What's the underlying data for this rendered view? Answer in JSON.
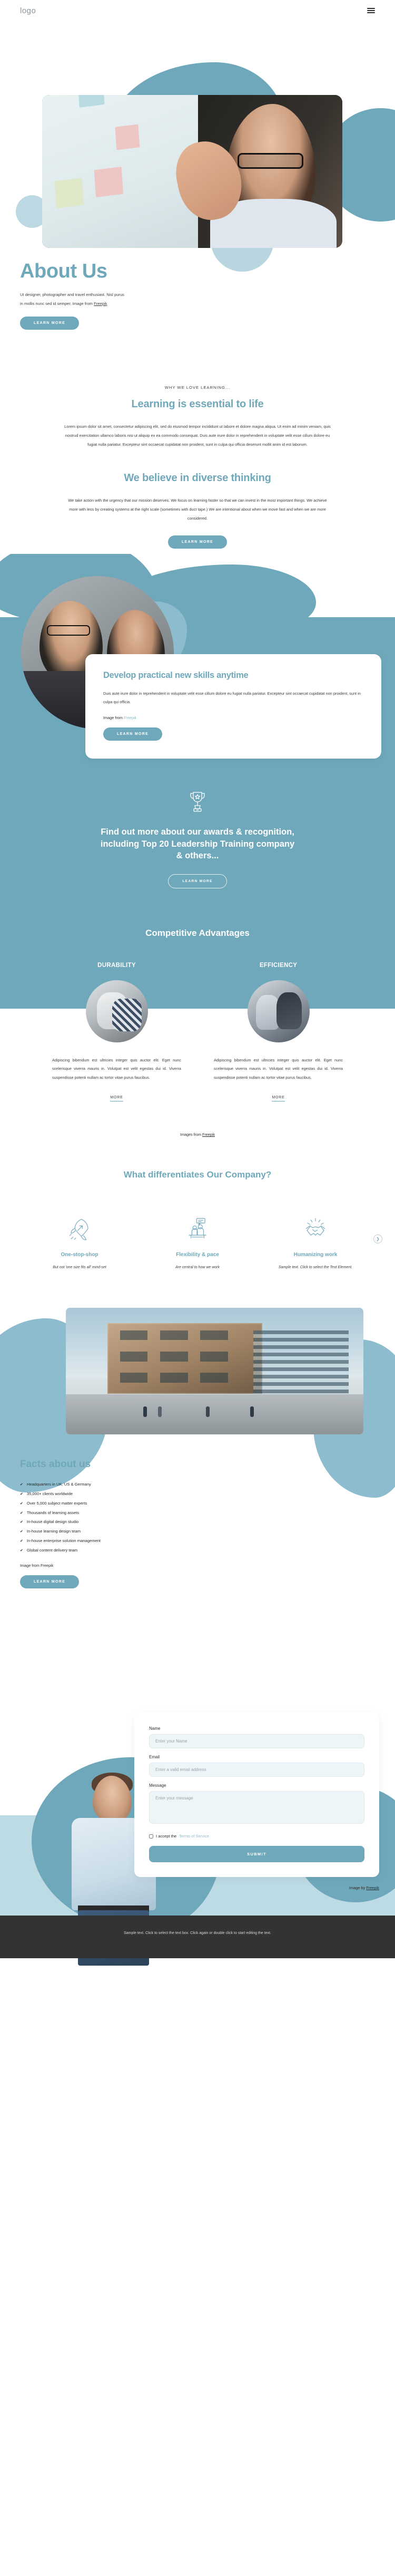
{
  "header": {
    "logo": "logo",
    "menu_icon": "hamburger-menu-icon"
  },
  "hero": {
    "title": "About Us",
    "paragraph": "UI designer, photographer and travel enthusiast. Nisl purus in mollis nunc sed id semper.  Image from ",
    "credit_link": "Freepik",
    "cta": "LEARN MORE"
  },
  "learning": {
    "eyebrow": "WHY WE LOVE LEARNING...",
    "title": "Learning is essential to life",
    "paragraph": "Lorem ipsum dolor sit amet, consectetur adipiscing elit, sed do eiusmod tempor incididunt ut labore et dolore magna aliqua. Ut enim ad minim veniam, quis nostrud exercitation ullamco laboris nisi ut aliquip ex ea commodo consequat. Duis aute irure dolor in reprehenderit in voluptate velit esse cillum dolore eu fugiat nulla pariatur. Excepteur sint occaecat cupidatat non proident, sunt in culpa qui officia deserunt mollit anim id est laborum."
  },
  "diverse": {
    "title": "We believe in diverse thinking",
    "paragraph": "We take action with the urgency that our mission deserves. We focus on learning faster so that we can invest in the most important things. We achieve more with less by creating systems at the right scale (sometimes with duct tape.) We are intentional about when we move fast and when we are more considered.",
    "cta": "LEARN MORE"
  },
  "skills": {
    "title": "Develop practical new skills anytime",
    "paragraph": "Duis aute irure dolor in reprehenderit in voluptate velit esse cillum dolore eu fugiat nulla pariatur. Excepteur sint occaecat cupidatat non proident, sunt in culpa qui officia.",
    "credit_prefix": "Image from ",
    "credit_link": "Freepik",
    "cta": "LEARN MORE"
  },
  "awards": {
    "icon": "trophy-icon",
    "title": "Find out more about our awards & recognition, including Top 20 Leadership Training company & others...",
    "cta": "LEARN MORE"
  },
  "competitive": {
    "title": "Competitive Advantages",
    "columns": [
      {
        "heading": "DURABILITY",
        "image": "people-working-photo",
        "paragraph": "Adipiscing bibendum est ultricies integer quis auctor elit. Eget nunc scelerisque viverra mauris in. Volutpat est velit egestas dui id. Viverra suspendisse potenti nullam ac tortor vitae purus faucibus.",
        "more": "MORE"
      },
      {
        "heading": "EFFICIENCY",
        "image": "business-meeting-photo",
        "paragraph": "Adipiscing bibendum est ultricies integer quis auctor elit. Eget nunc scelerisque viverra mauris in. Volutpat est velit egestas dui id. Viverra suspendisse potenti nullam ac tortor vitae purus faucibus.",
        "more": "MORE"
      }
    ],
    "credit_prefix": "Images from ",
    "credit_link": "Freepik"
  },
  "differentiates": {
    "title": "What differentiates Our Company?",
    "next_icon": "chevron-right-icon",
    "items": [
      {
        "icon": "rocket-icon",
        "heading": "One-stop-shop",
        "text": "But not 'one size fits all' mind-set"
      },
      {
        "icon": "meeting-presentation-icon",
        "heading": "Flexibility & pace",
        "text": "Are central to how we work"
      },
      {
        "icon": "handshake-icon",
        "heading": "Humanizing work",
        "text": "Sample text. Click to select the Text Element."
      }
    ]
  },
  "facts": {
    "image": "modern-office-building-photo",
    "title": "Facts about us",
    "tick": "✔",
    "items": [
      "Headquarters in UK, US & Germany",
      "35,000+ clients worldwide",
      "Over 5,000 subject matter experts",
      "Thousands of learning assets",
      "In-house digital design studio",
      "In-house learning design team",
      "In-house enterprise solution management",
      "Global content delivery team"
    ],
    "credit_prefix": "Image from ",
    "credit_link": "Freepik",
    "cta": "LEARN MORE"
  },
  "contact": {
    "image": "smiling-businessman-photo",
    "name_label": "Name",
    "name_placeholder": "Enter your Name",
    "email_label": "Email",
    "email_placeholder": "Enter a valid email address",
    "message_label": "Message",
    "message_placeholder": "Enter your message",
    "accept_text": "I accept the ",
    "terms_link": "Terms of Service",
    "submit": "SUBMIT",
    "credit_prefix": "Image by ",
    "credit_link": "Freepik"
  },
  "footer": {
    "text": "Sample text. Click to select the text box. Click again or double click to start editing the text."
  },
  "colors": {
    "accent": "#6fa8bb",
    "accent_light": "#8cbcce",
    "accent_pale": "#bddbe5",
    "text": "#3c4043",
    "footer_bg": "#333333"
  }
}
